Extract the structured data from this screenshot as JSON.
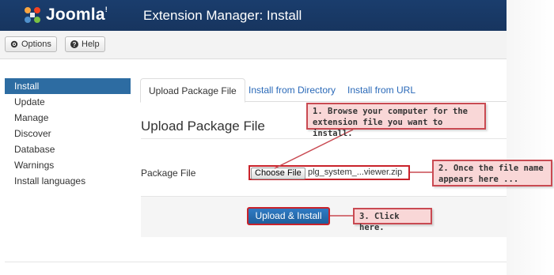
{
  "header": {
    "logo_text": "Joomla",
    "logo_reg": "!",
    "page_title": "Extension Manager: Install"
  },
  "toolbar": {
    "options_label": "Options",
    "help_label": "Help"
  },
  "sidebar": {
    "items": [
      {
        "label": "Install",
        "active": true
      },
      {
        "label": "Update"
      },
      {
        "label": "Manage"
      },
      {
        "label": "Discover"
      },
      {
        "label": "Database"
      },
      {
        "label": "Warnings"
      },
      {
        "label": "Install languages"
      }
    ]
  },
  "tabs": [
    {
      "label": "Upload Package File",
      "active": true
    },
    {
      "label": "Install from Directory"
    },
    {
      "label": "Install from URL"
    }
  ],
  "main": {
    "section_title": "Upload Package File",
    "package_label": "Package File",
    "choose_file_label": "Choose File",
    "file_name": "plg_system_...viewer.zip",
    "upload_button_label": "Upload & Install"
  },
  "callouts": {
    "step1_line1": "1. Browse your computer for the",
    "step1_line2": "extension file you want to install.",
    "step2_line1": "2. Once the file name",
    "step2_line2": "appears here ...",
    "step3": "3. Click here."
  },
  "colors": {
    "header_bg": "#1a3d6d",
    "active_blue": "#2d6ca2",
    "link_blue": "#2a69b8",
    "callout_bg": "#f9d7d7",
    "callout_border": "#c94a52",
    "highlight_red": "#c9222a"
  }
}
